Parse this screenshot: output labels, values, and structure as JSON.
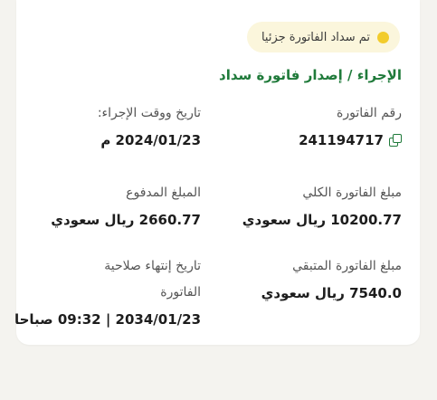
{
  "status_badge": {
    "text": "تم سداد الفاتورة جزئيا",
    "color": "#f2cc2c"
  },
  "action": {
    "text": "الإجراء / إصدار فاتورة سداد"
  },
  "fields": {
    "invoice_number": {
      "label": "رقم الفاتورة",
      "value": "241194717",
      "icon": "copy-icon"
    },
    "action_datetime": {
      "label": "تاريخ ووقت الإجراء:",
      "value": "2024/01/23 م"
    },
    "total_amount": {
      "label": "مبلغ الفاتورة الكلي",
      "value": "10200.77 ريال سعودي"
    },
    "paid_amount": {
      "label": "المبلغ المدفوع",
      "value": "2660.77 ريال سعودي"
    },
    "remaining_amount": {
      "label": "مبلغ الفاتورة المتبقي",
      "value": "7540.0 ريال سعودي"
    },
    "expiry": {
      "label_line1": "تاريخ إنتهاء صلاحية",
      "label_line2": "الفاتورة",
      "value": "2034/01/23 | 09:32 صباحا"
    }
  },
  "colors": {
    "accent_green": "#1f7a3a",
    "badge_bg": "#fbf6dc",
    "page_bg": "#f4f3ef"
  }
}
